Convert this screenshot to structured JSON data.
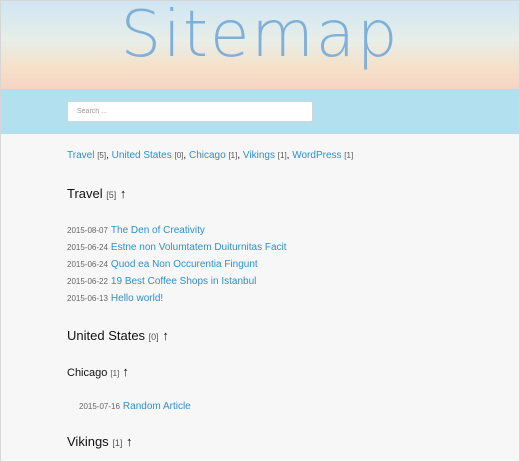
{
  "header": {
    "title": "Sitemap"
  },
  "search": {
    "placeholder": "Search ..."
  },
  "category_links": [
    {
      "name": "Travel",
      "count": "[5]",
      "sep": ","
    },
    {
      "name": "United States",
      "count": "[0]",
      "sep": ","
    },
    {
      "name": "Chicago",
      "count": "[1]",
      "sep": ","
    },
    {
      "name": "Vikings",
      "count": "[1]",
      "sep": ","
    },
    {
      "name": "WordPress",
      "count": "[1]",
      "sep": ""
    }
  ],
  "sections": {
    "travel": {
      "title": "Travel",
      "count": "[5]",
      "arrow": "↑",
      "posts": [
        {
          "date": "2015-08-07",
          "title": "The Den of Creativity"
        },
        {
          "date": "2015-06-24",
          "title": "Estne non Volumtatem Duiturnitas Facit"
        },
        {
          "date": "2015-06-24",
          "title": "Quod ea Non Occurentia Fingunt"
        },
        {
          "date": "2015-06-22",
          "title": "19 Best Coffee Shops in Istanbul"
        },
        {
          "date": "2015-06-13",
          "title": "Hello world!"
        }
      ]
    },
    "united_states": {
      "title": "United States",
      "count": "[0]",
      "arrow": "↑"
    },
    "chicago": {
      "title": "Chicago",
      "count": "[1]",
      "arrow": "↑",
      "posts": [
        {
          "date": "2015-07-16",
          "title": "Random Article"
        }
      ]
    },
    "vikings": {
      "title": "Vikings",
      "count": "[1]",
      "arrow": "↑"
    }
  }
}
